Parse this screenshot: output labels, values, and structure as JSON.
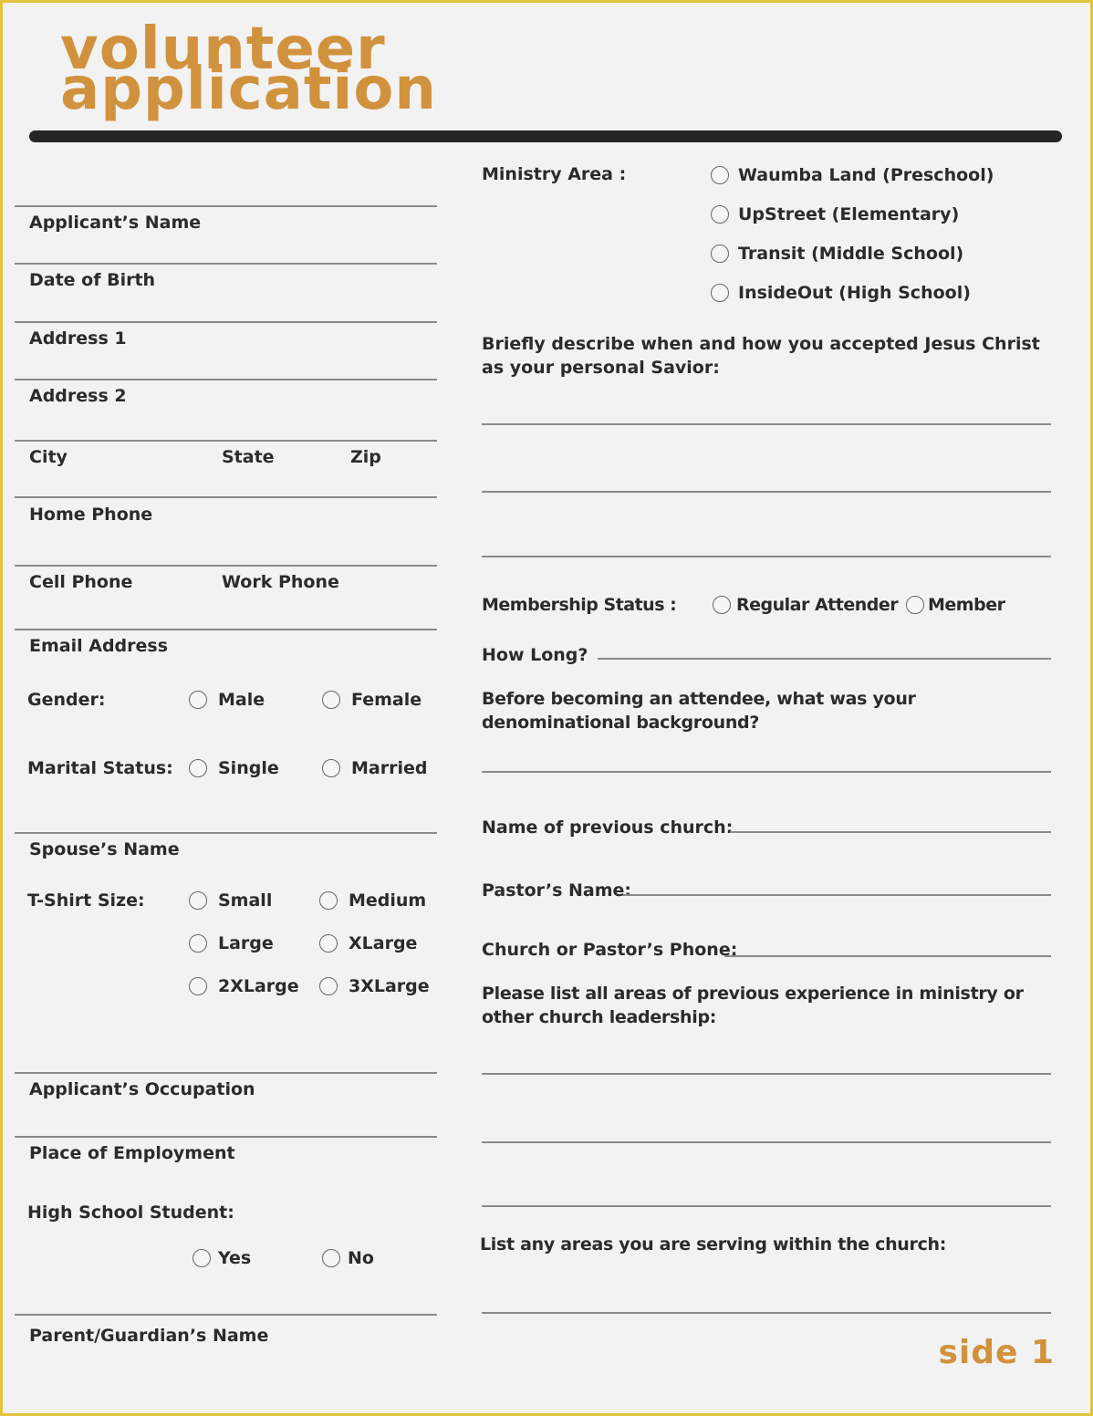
{
  "header": {
    "title_line1": "volunteer",
    "title_line2": "application",
    "accent_color": "#d1923d"
  },
  "left": {
    "applicant_name": "Applicant’s Name",
    "date_of_birth": "Date of Birth",
    "address1": "Address 1",
    "address2": "Address 2",
    "city": "City",
    "state": "State",
    "zip": "Zip",
    "home_phone": "Home Phone",
    "cell_phone": "Cell Phone",
    "work_phone": "Work Phone",
    "email": "Email Address",
    "gender": {
      "label": "Gender:",
      "options": [
        "Male",
        "Female"
      ]
    },
    "marital": {
      "label": "Marital Status:",
      "options": [
        "Single",
        "Married"
      ]
    },
    "spouse_name": "Spouse’s Name",
    "tshirt": {
      "label": "T-Shirt Size:",
      "options": [
        "Small",
        "Medium",
        "Large",
        "XLarge",
        "2XLarge",
        "3XLarge"
      ]
    },
    "occupation": "Applicant’s Occupation",
    "employment": "Place of Employment",
    "hs_student": {
      "label": "High School Student:",
      "options": [
        "Yes",
        "No"
      ]
    },
    "parent_name": "Parent/Guardian’s Name"
  },
  "right": {
    "ministry": {
      "label": "Ministry Area :",
      "options": [
        "Waumba Land (Preschool)",
        "UpStreet (Elementary)",
        "Transit (Middle School)",
        "InsideOut (High School)"
      ]
    },
    "savior_q": "Briefly describe when and how you accepted Jesus Christ as your personal Savior:",
    "membership": {
      "label": "Membership Status :",
      "options": [
        "Regular Attender",
        "Member"
      ]
    },
    "how_long": "How Long?",
    "denom_q": "Before becoming an attendee, what was your denominational background?",
    "prev_church": "Name of previous church:",
    "pastor_name": "Pastor’s Name:",
    "church_phone": "Church or Pastor’s Phone:",
    "experience_q": "Please list all areas of previous experience in ministry or other church leadership:",
    "serving_q": "List any areas you are serving within the church:"
  },
  "footer": {
    "side": "side 1"
  }
}
